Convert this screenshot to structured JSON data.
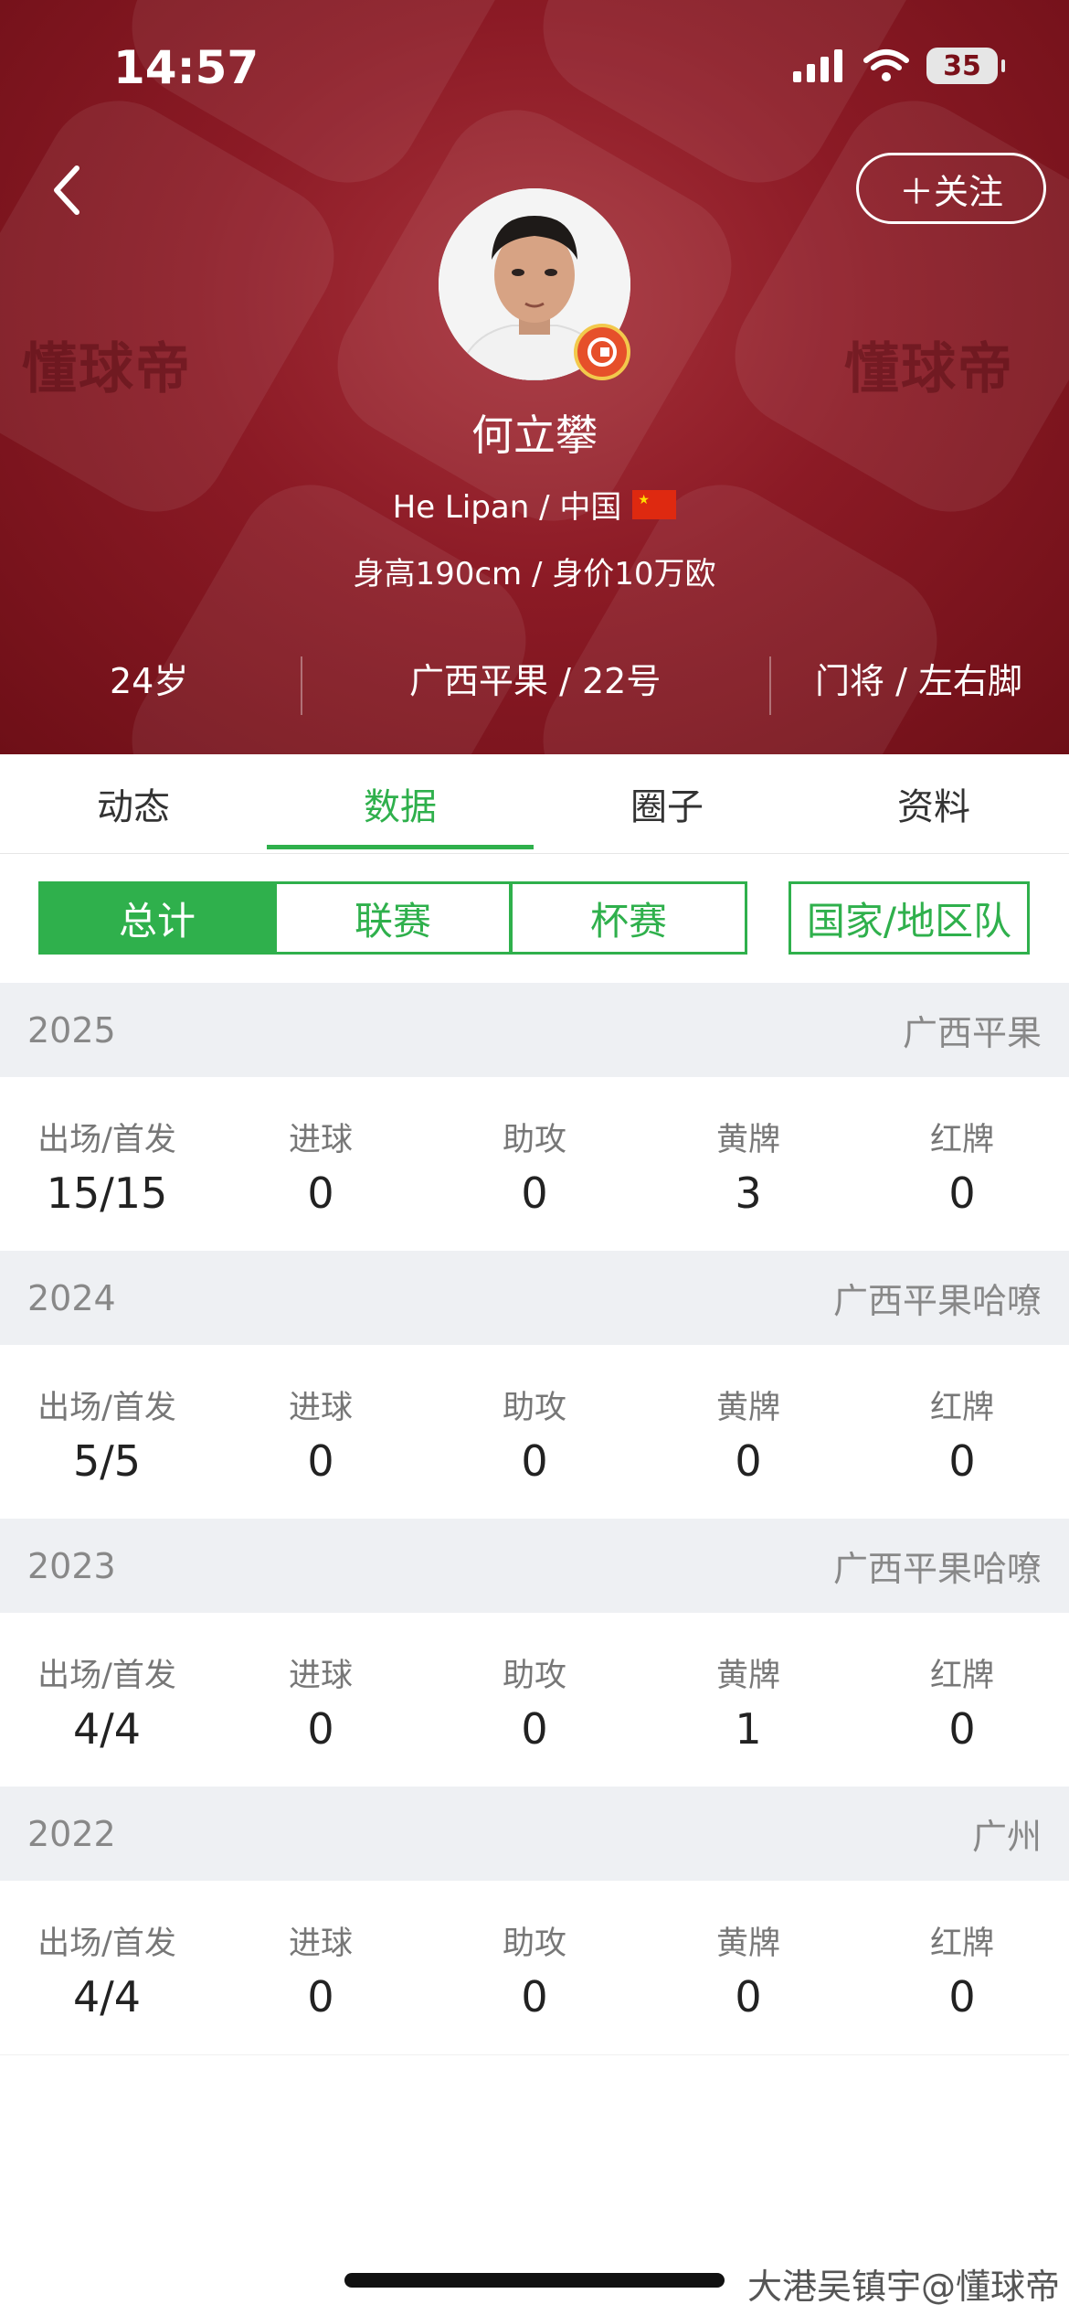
{
  "status_bar": {
    "time": "14:57",
    "battery": "35"
  },
  "header": {
    "watermark": "懂球帝",
    "follow_label": "＋关注",
    "name": "何立攀",
    "english_name_country": "He Lipan / 中国",
    "info_line": "身高190cm / 身价10万欧",
    "age": "24岁",
    "club_number": "广西平果 / 22号",
    "position_foot": "门将 / 左右脚"
  },
  "tabs": [
    "动态",
    "数据",
    "圈子",
    "资料"
  ],
  "active_tab": "数据",
  "segments": [
    "总计",
    "联赛",
    "杯赛"
  ],
  "segment_extra": "国家/地区队",
  "stat_labels": [
    "出场/首发",
    "进球",
    "助攻",
    "黄牌",
    "红牌"
  ],
  "seasons": [
    {
      "year": "2025",
      "team": "广西平果",
      "values": [
        "15/15",
        "0",
        "0",
        "3",
        "0"
      ]
    },
    {
      "year": "2024",
      "team": "广西平果哈嘹",
      "values": [
        "5/5",
        "0",
        "0",
        "0",
        "0"
      ]
    },
    {
      "year": "2023",
      "team": "广西平果哈嘹",
      "values": [
        "4/4",
        "0",
        "0",
        "1",
        "0"
      ]
    },
    {
      "year": "2022",
      "team": "广州",
      "values": [
        "4/4",
        "0",
        "0",
        "0",
        "0"
      ]
    }
  ],
  "footer_credit": "大港吴镇宇@懂球帝",
  "colors": {
    "accent": "#2fb04c",
    "header_red": "#8b1a25"
  }
}
